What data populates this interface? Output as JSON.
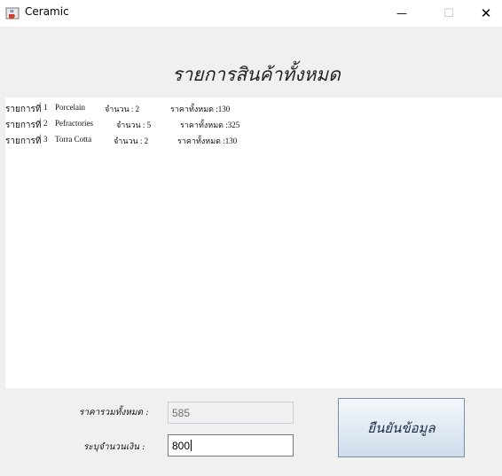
{
  "window": {
    "title": "Ceramic",
    "icon": "java-cup-icon",
    "minimize_glyph": "—",
    "maximize_glyph": "☐",
    "close_glyph": "✕"
  },
  "heading": "รายการสินค้าทั้งหมด",
  "items": [
    {
      "label": "รายการที่",
      "number": "1",
      "name": "Porcelain",
      "qty_text": "จำนวน : 2",
      "total_text": "ราคาทั้งหมด :130"
    },
    {
      "label": "รายการที่",
      "number": "2",
      "name": "Pefractories",
      "qty_text": "จำนวน : 5",
      "total_text": "ราคาทั้งหมด :325"
    },
    {
      "label": "รายการที่",
      "number": "3",
      "name": "Torra Cotta",
      "qty_text": "จำนวน : 2",
      "total_text": "ราคาทั้งหมด :130"
    }
  ],
  "form": {
    "total_label": "ราคารวมทั้งหมด :",
    "total_value": "585",
    "amount_label": "ระบุจำนวนเงิน :",
    "amount_value": "800",
    "confirm_label": "ยืนยันข้อมูล"
  },
  "colors": {
    "background": "#f0f0f0",
    "list_background": "#ffffff",
    "button_gradient_top": "#f4f8fc",
    "button_gradient_bottom": "#cfdceb"
  }
}
